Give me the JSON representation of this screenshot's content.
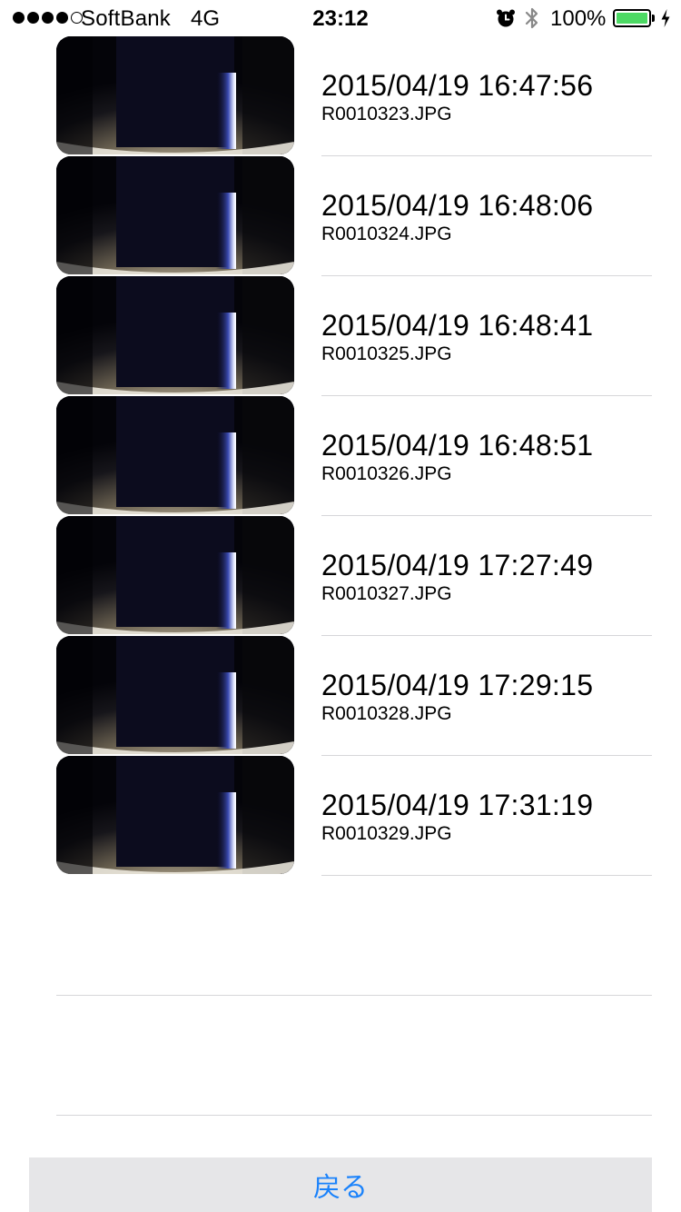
{
  "status_bar": {
    "carrier": "SoftBank",
    "network": "4G",
    "time": "23:12",
    "battery_percent": "100%",
    "signal_bars_filled": 4,
    "signal_bars_total": 5,
    "battery_color": "#4cd964"
  },
  "photos": [
    {
      "datetime": "2015/04/19 16:47:56",
      "filename": "R0010323.JPG"
    },
    {
      "datetime": "2015/04/19 16:48:06",
      "filename": "R0010324.JPG"
    },
    {
      "datetime": "2015/04/19 16:48:41",
      "filename": "R0010325.JPG"
    },
    {
      "datetime": "2015/04/19 16:48:51",
      "filename": "R0010326.JPG"
    },
    {
      "datetime": "2015/04/19 17:27:49",
      "filename": "R0010327.JPG"
    },
    {
      "datetime": "2015/04/19 17:29:15",
      "filename": "R0010328.JPG"
    },
    {
      "datetime": "2015/04/19 17:31:19",
      "filename": "R0010329.JPG"
    }
  ],
  "back_button": {
    "label": "戻る",
    "color": "#1a82fb"
  }
}
